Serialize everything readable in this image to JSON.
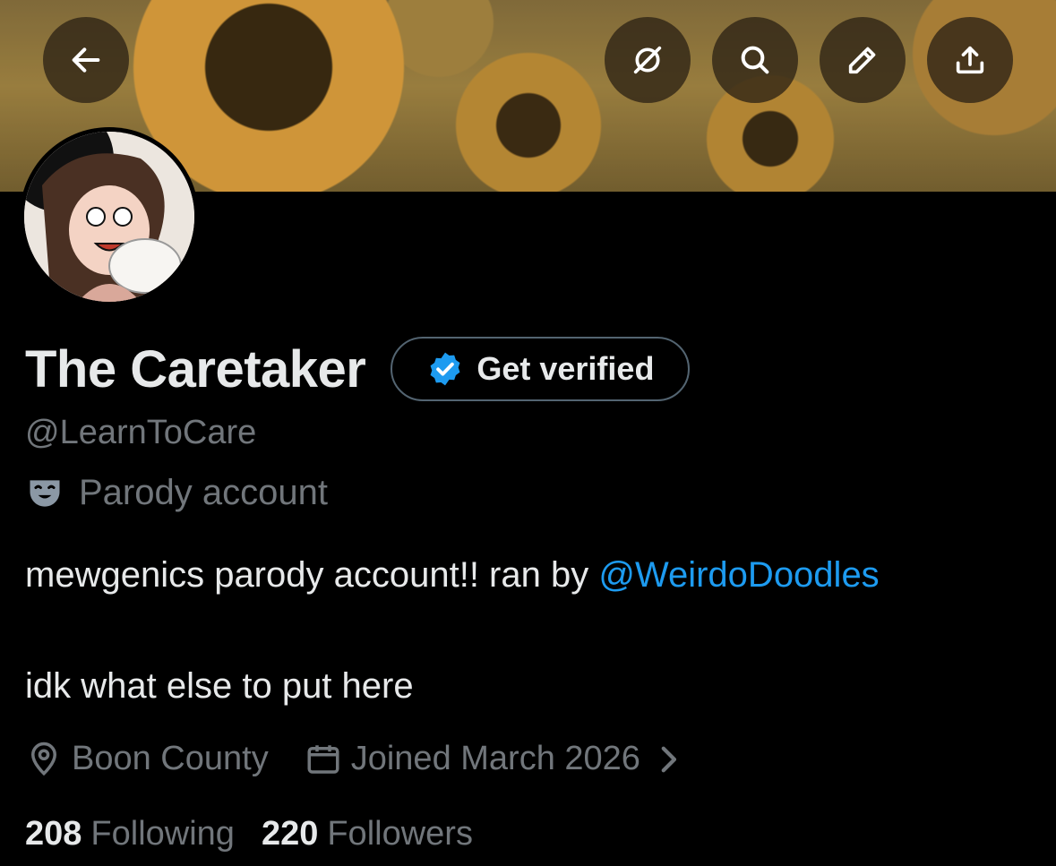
{
  "header": {
    "buttons": [
      {
        "name": "back-button",
        "icon": "arrow-left-icon"
      },
      {
        "name": "grok-button",
        "icon": "grok-icon"
      },
      {
        "name": "search-button",
        "icon": "search-icon"
      },
      {
        "name": "edit-button",
        "icon": "pencil-icon"
      },
      {
        "name": "share-button",
        "icon": "share-upload-icon"
      }
    ]
  },
  "profile": {
    "display_name": "The Caretaker",
    "get_verified_label": "Get verified",
    "handle": "@LearnToCare",
    "parody_label": "Parody account",
    "bio_line1_prefix": "mewgenics parody account!! ran by ",
    "bio_mention": "@WeirdoDoodles",
    "bio_line2": "idk what else to put here",
    "location": "Boon County",
    "joined": "Joined March 2026",
    "following_count": "208",
    "following_label": "Following",
    "followers_count": "220",
    "followers_label": "Followers"
  },
  "colors": {
    "accent": "#1d9bf0",
    "secondary_text": "#71767b",
    "primary_text": "#e7e9ea",
    "background": "#000000"
  }
}
